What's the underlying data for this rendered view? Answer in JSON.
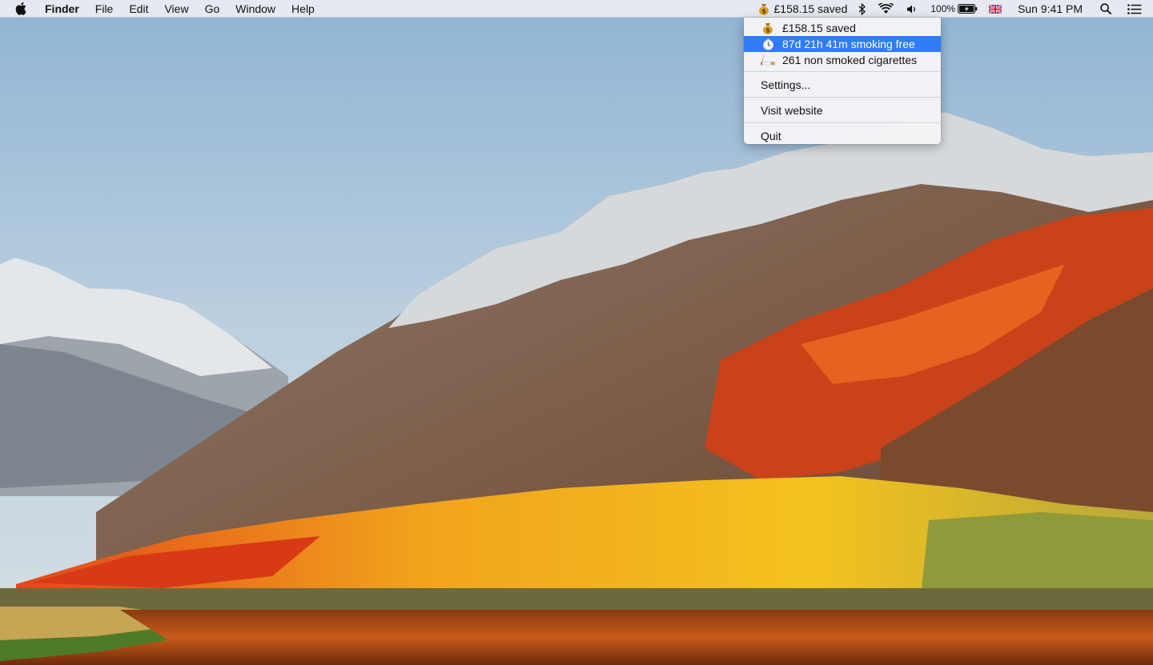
{
  "menubar": {
    "app_name": "Finder",
    "menus": [
      "File",
      "Edit",
      "View",
      "Go",
      "Window",
      "Help"
    ],
    "status": {
      "app_title": "£158.15 saved",
      "battery": "100%",
      "clock": "Sun 9:41 PM",
      "input_source": "British flag"
    }
  },
  "dropdown": {
    "stats": [
      {
        "icon": "money-bag-icon",
        "label": "£158.15 saved"
      },
      {
        "icon": "stopwatch-icon",
        "label": "87d 21h 41m smoking free",
        "highlighted": true
      },
      {
        "icon": "cigarette-icon",
        "label": "261 non smoked cigarettes"
      }
    ],
    "settings_label": "Settings...",
    "website_label": "Visit website",
    "quit_label": "Quit"
  },
  "colors": {
    "highlight": "#2f7cf6",
    "menubar_bg": "#eceef2"
  }
}
